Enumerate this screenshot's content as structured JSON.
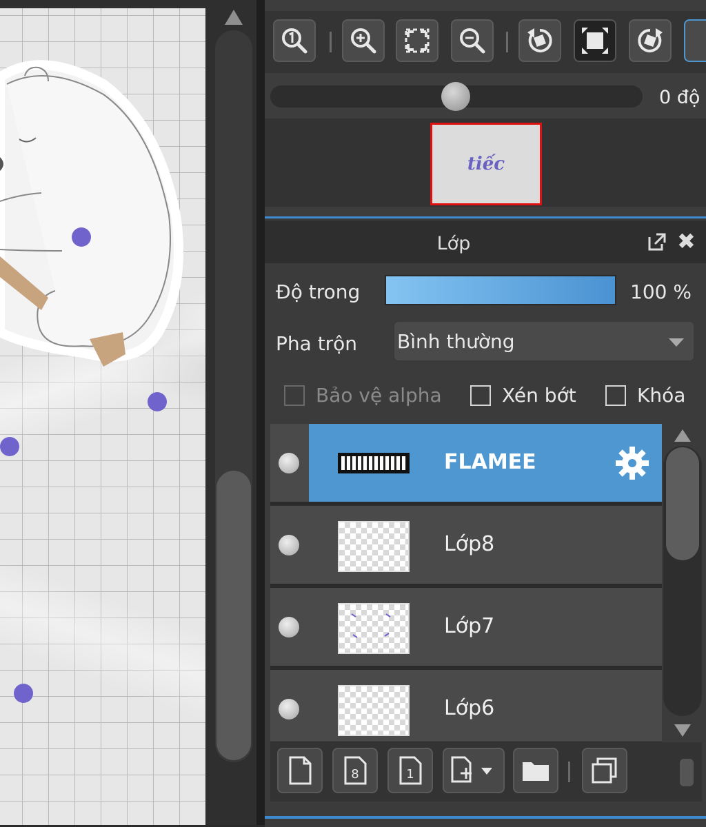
{
  "navigator": {
    "rotation_value": "0 độ",
    "rotation_fraction": 0.5,
    "preview_label": "tiếc"
  },
  "layer_panel": {
    "title": "Lớp",
    "opacity_label": "Độ trong",
    "opacity_value": "100 %",
    "opacity_fraction": 1.0,
    "blend_label": "Pha trộn",
    "blend_value": "Bình thường",
    "checkboxes": {
      "protect_alpha": "Bảo vệ alpha",
      "clipping": "Xén bớt",
      "lock": "Khóa"
    },
    "layers": [
      {
        "name": "FLAMEE",
        "selected": true
      },
      {
        "name": "Lớp8",
        "selected": false
      },
      {
        "name": "Lớp7",
        "selected": false
      },
      {
        "name": "Lớp6",
        "selected": false
      }
    ]
  },
  "colors": {
    "accent": "#3d8ad0",
    "selected_row": "#4f97d0",
    "canvas_dot": "#7064cc",
    "navigator_border": "#e01010"
  },
  "icons": {
    "toolbar": [
      "zoom-actual-icon",
      "zoom-in-icon",
      "fit-screen-icon",
      "zoom-out-icon",
      "rotate-left-icon",
      "reset-view-icon",
      "rotate-right-icon"
    ],
    "layer_toolbar": [
      "new-layer-icon",
      "new-8bit-layer-icon",
      "new-1bit-layer-icon",
      "add-layer-dropdown-icon",
      "new-folder-icon",
      "duplicate-layer-icon"
    ]
  }
}
